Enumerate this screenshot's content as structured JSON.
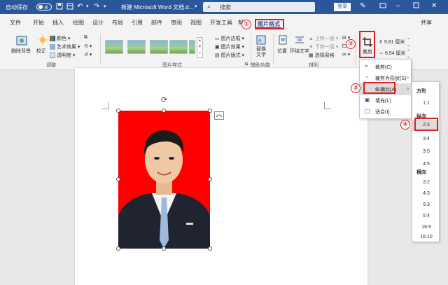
{
  "titlebar": {
    "autosave_label": "自动保存",
    "autosave_state": "关",
    "doc_title": "新建 Microsoft Word 文档.d...",
    "search_placeholder": "搜索",
    "login_label": "登录",
    "icons": [
      "save-icon",
      "layout-icon",
      "undo-icon",
      "redo-icon",
      "customize-icon",
      "pen-icon",
      "restore-icon",
      "minimize-icon",
      "maximize-icon",
      "close-icon"
    ]
  },
  "tabs": [
    "文件",
    "开始",
    "插入",
    "绘图",
    "设计",
    "布局",
    "引用",
    "邮件",
    "审阅",
    "视图",
    "开发工具",
    "帮",
    "图片格式"
  ],
  "share_label": "共享",
  "ribbon": {
    "remove_bg": "删除背景",
    "correct": "校正",
    "color": "颜色",
    "art_effect": "艺术效果",
    "transparency": "透明度",
    "group_adjust": "调整",
    "group_styles": "图片样式",
    "pic_border": "图片边框",
    "pic_effect": "图片效果",
    "pic_layout": "图片版式",
    "alt_text": "替换文字",
    "group_access": "辅助功能",
    "position": "位置",
    "wrap_text": "环绕文字",
    "bring_forward": "上移一层",
    "send_backward": "下移一层",
    "selection_pane": "选择窗格",
    "group_arrange": "排列",
    "crop": "裁剪",
    "height": "9.81 厘米",
    "width": "6.54 厘米"
  },
  "crop_menu": {
    "items": [
      {
        "label": "裁剪(C)",
        "icon": "crop-icon"
      },
      {
        "label": "裁剪为形状(S)",
        "icon": "shape-icon",
        "arrow": "›"
      },
      {
        "label": "纵横比(A)",
        "icon": "",
        "arrow": "›"
      },
      {
        "label": "填充(L)",
        "icon": "fill-icon"
      },
      {
        "label": "适合(I)",
        "icon": "fit-icon"
      }
    ]
  },
  "aspect_submenu": {
    "square_header": "方形",
    "square": [
      "1:1"
    ],
    "portrait_header": "纵向",
    "portrait": [
      "2:3",
      "3:4",
      "3:5",
      "4:5"
    ],
    "landscape_header": "横向",
    "landscape": [
      "3:2",
      "4:3",
      "5:3",
      "5:4",
      "16:9",
      "16:10"
    ]
  },
  "annotations": [
    "①",
    "②",
    "③",
    "④"
  ],
  "colors": {
    "brand": "#2b579a",
    "annotation": "#e02020",
    "photo_bg": "#ff0000"
  }
}
